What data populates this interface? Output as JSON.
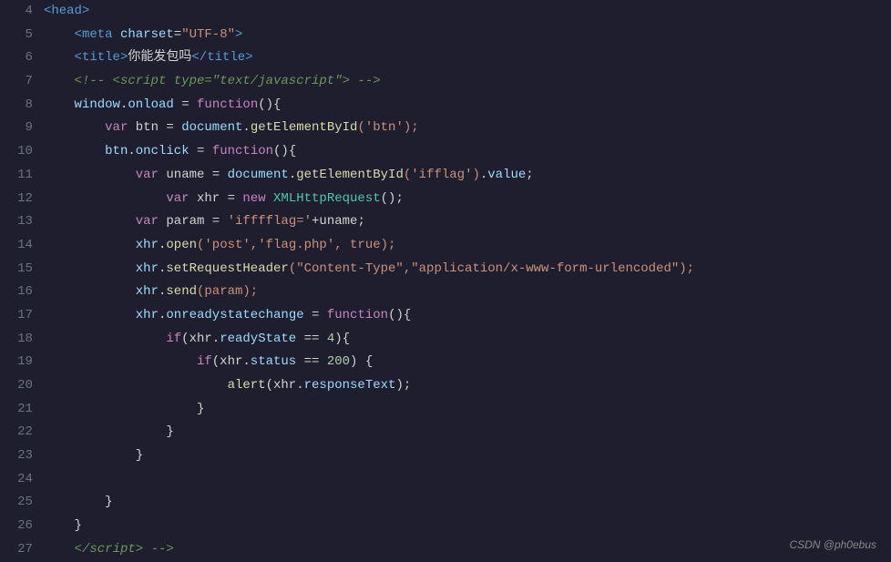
{
  "lines": [
    {
      "num": "4",
      "tokens": [
        {
          "t": "<",
          "c": "c-tag"
        },
        {
          "t": "head",
          "c": "c-tag"
        },
        {
          "t": ">",
          "c": "c-tag"
        }
      ]
    },
    {
      "num": "5",
      "indent": "    ",
      "tokens": [
        {
          "t": "<",
          "c": "c-tag"
        },
        {
          "t": "meta",
          "c": "c-tag"
        },
        {
          "t": " charset",
          "c": "c-attr"
        },
        {
          "t": "=",
          "c": "c-equal"
        },
        {
          "t": "\"UTF-8\"",
          "c": "c-string"
        },
        {
          "t": ">",
          "c": "c-tag"
        }
      ]
    },
    {
      "num": "6",
      "indent": "    ",
      "tokens": [
        {
          "t": "<",
          "c": "c-tag"
        },
        {
          "t": "title",
          "c": "c-tag"
        },
        {
          "t": ">",
          "c": "c-tag"
        },
        {
          "t": "你能发包吗",
          "c": "c-white"
        },
        {
          "t": "</",
          "c": "c-tag"
        },
        {
          "t": "title",
          "c": "c-tag"
        },
        {
          "t": ">",
          "c": "c-tag"
        }
      ]
    },
    {
      "num": "7",
      "indent": "    ",
      "tokens": [
        {
          "t": "<!-- <script type=",
          "c": "c-comment"
        },
        {
          "t": "\"text/javascript\"",
          "c": "c-comment"
        },
        {
          "t": "> -->",
          "c": "c-comment"
        }
      ]
    },
    {
      "num": "8",
      "indent": "    ",
      "tokens": [
        {
          "t": "window",
          "c": "c-obj"
        },
        {
          "t": ".",
          "c": "c-punct"
        },
        {
          "t": "onload",
          "c": "c-obj"
        },
        {
          "t": " = ",
          "c": "c-equal"
        },
        {
          "t": "function",
          "c": "c-keyword"
        },
        {
          "t": "(){",
          "c": "c-white"
        }
      ]
    },
    {
      "num": "9",
      "indent": "        ",
      "tokens": [
        {
          "t": "var",
          "c": "c-keyword"
        },
        {
          "t": " btn = ",
          "c": "c-white"
        },
        {
          "t": "document",
          "c": "c-obj"
        },
        {
          "t": ".",
          "c": "c-punct"
        },
        {
          "t": "getElementById",
          "c": "c-yellow"
        },
        {
          "t": "('btn');",
          "c": "c-orange"
        }
      ]
    },
    {
      "num": "10",
      "indent": "        ",
      "tokens": [
        {
          "t": "btn",
          "c": "c-obj"
        },
        {
          "t": ".",
          "c": "c-punct"
        },
        {
          "t": "onclick",
          "c": "c-obj"
        },
        {
          "t": " = ",
          "c": "c-equal"
        },
        {
          "t": "function",
          "c": "c-keyword"
        },
        {
          "t": "(){",
          "c": "c-white"
        }
      ]
    },
    {
      "num": "11",
      "indent": "            ",
      "tokens": [
        {
          "t": "var",
          "c": "c-keyword"
        },
        {
          "t": " uname = ",
          "c": "c-white"
        },
        {
          "t": "document",
          "c": "c-obj"
        },
        {
          "t": ".",
          "c": "c-punct"
        },
        {
          "t": "getElementById",
          "c": "c-yellow"
        },
        {
          "t": "('ifflag')",
          "c": "c-orange"
        },
        {
          "t": ".",
          "c": "c-punct"
        },
        {
          "t": "value",
          "c": "c-obj"
        },
        {
          "t": ";",
          "c": "c-white"
        }
      ]
    },
    {
      "num": "12",
      "indent": "                ",
      "tokens": [
        {
          "t": "var",
          "c": "c-keyword"
        },
        {
          "t": " xhr = ",
          "c": "c-white"
        },
        {
          "t": "new",
          "c": "c-keyword"
        },
        {
          "t": " XMLHttpRequest",
          "c": "c-green"
        },
        {
          "t": "();",
          "c": "c-white"
        }
      ]
    },
    {
      "num": "13",
      "indent": "            ",
      "tokens": [
        {
          "t": "var",
          "c": "c-keyword"
        },
        {
          "t": " param = ",
          "c": "c-white"
        },
        {
          "t": "'ifffflag='",
          "c": "c-orange"
        },
        {
          "t": "+uname;",
          "c": "c-white"
        }
      ]
    },
    {
      "num": "14",
      "indent": "            ",
      "tokens": [
        {
          "t": "xhr",
          "c": "c-obj"
        },
        {
          "t": ".",
          "c": "c-punct"
        },
        {
          "t": "open",
          "c": "c-yellow"
        },
        {
          "t": "('post','flag.php', true);",
          "c": "c-orange"
        }
      ]
    },
    {
      "num": "15",
      "indent": "            ",
      "tokens": [
        {
          "t": "xhr",
          "c": "c-obj"
        },
        {
          "t": ".",
          "c": "c-punct"
        },
        {
          "t": "setRequestHeader",
          "c": "c-yellow"
        },
        {
          "t": "(\"Content-Type\",\"application/x-www-form-urlencoded\");",
          "c": "c-orange"
        }
      ]
    },
    {
      "num": "16",
      "indent": "            ",
      "tokens": [
        {
          "t": "xhr",
          "c": "c-obj"
        },
        {
          "t": ".",
          "c": "c-punct"
        },
        {
          "t": "send",
          "c": "c-yellow"
        },
        {
          "t": "(param);",
          "c": "c-orange"
        }
      ]
    },
    {
      "num": "17",
      "indent": "            ",
      "tokens": [
        {
          "t": "xhr",
          "c": "c-obj"
        },
        {
          "t": ".",
          "c": "c-punct"
        },
        {
          "t": "onreadystatechange",
          "c": "c-obj"
        },
        {
          "t": " = ",
          "c": "c-equal"
        },
        {
          "t": "function",
          "c": "c-keyword"
        },
        {
          "t": "(){",
          "c": "c-white"
        }
      ]
    },
    {
      "num": "18",
      "indent": "                ",
      "tokens": [
        {
          "t": "if",
          "c": "c-keyword"
        },
        {
          "t": "(xhr",
          "c": "c-white"
        },
        {
          "t": ".",
          "c": "c-punct"
        },
        {
          "t": "readyState",
          "c": "c-obj"
        },
        {
          "t": " == ",
          "c": "c-equal"
        },
        {
          "t": "4",
          "c": "c-number"
        },
        {
          "t": "){",
          "c": "c-white"
        }
      ]
    },
    {
      "num": "19",
      "indent": "                    ",
      "tokens": [
        {
          "t": "if",
          "c": "c-keyword"
        },
        {
          "t": "(xhr",
          "c": "c-white"
        },
        {
          "t": ".",
          "c": "c-punct"
        },
        {
          "t": "status",
          "c": "c-obj"
        },
        {
          "t": " == ",
          "c": "c-equal"
        },
        {
          "t": "200",
          "c": "c-number"
        },
        {
          "t": ") {",
          "c": "c-white"
        }
      ]
    },
    {
      "num": "20",
      "indent": "                        ",
      "tokens": [
        {
          "t": "alert",
          "c": "c-yellow"
        },
        {
          "t": "(xhr",
          "c": "c-white"
        },
        {
          "t": ".",
          "c": "c-punct"
        },
        {
          "t": "responseText",
          "c": "c-obj"
        },
        {
          "t": ");",
          "c": "c-white"
        }
      ]
    },
    {
      "num": "21",
      "indent": "                    ",
      "tokens": [
        {
          "t": "}",
          "c": "c-white"
        }
      ]
    },
    {
      "num": "22",
      "indent": "                ",
      "tokens": [
        {
          "t": "}",
          "c": "c-white"
        }
      ]
    },
    {
      "num": "23",
      "indent": "            ",
      "tokens": [
        {
          "t": "}",
          "c": "c-white"
        }
      ]
    },
    {
      "num": "24",
      "indent": "",
      "tokens": []
    },
    {
      "num": "25",
      "indent": "        ",
      "tokens": [
        {
          "t": "}",
          "c": "c-white"
        }
      ]
    },
    {
      "num": "26",
      "indent": "    ",
      "tokens": [
        {
          "t": "}",
          "c": "c-white"
        }
      ]
    },
    {
      "num": "27",
      "indent": "    ",
      "tokens": [
        {
          "t": "</",
          "c": "c-comment"
        },
        {
          "t": "script",
          "c": "c-comment"
        },
        {
          "t": "> -->",
          "c": "c-comment"
        }
      ]
    }
  ],
  "watermark": "CSDN @ph0ebus"
}
